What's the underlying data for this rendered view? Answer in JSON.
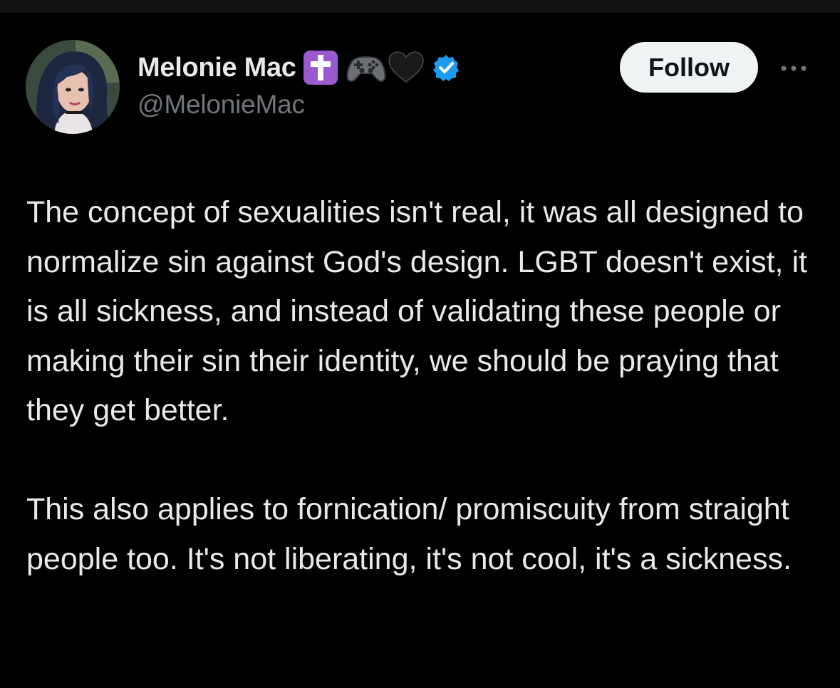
{
  "tweet": {
    "author": {
      "display_name": "Melonie Mac",
      "handle": "@MelonieMac",
      "name_emojis": [
        "latin-cross-emoji",
        "game-controller-emoji",
        "black-heart-emoji"
      ],
      "verified_color": "#1d9bf0"
    },
    "follow_label": "Follow",
    "more_icon": "more-horizontal-icon",
    "paragraphs": [
      "The concept of sexualities isn't real, it was all designed to normalize sin against God's design. LGBT doesn't exist, it is all sickness, and instead of validating these people or making their sin their identity, we should be praying that they get better.",
      "This also applies to fornication/ promiscuity from straight people too. It's not liberating, it's not cool, it's a sickness."
    ]
  },
  "colors": {
    "background": "#000000",
    "primary_text": "#e7e9ea",
    "secondary_text": "#71767b",
    "follow_button_bg": "#eff3f4",
    "follow_button_text": "#0f1419",
    "cross_bg": "#9b59d0"
  }
}
